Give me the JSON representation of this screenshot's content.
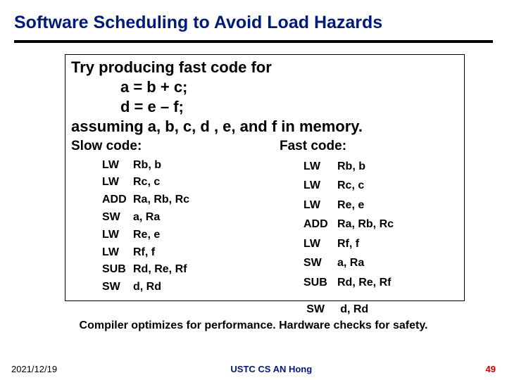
{
  "title": "Software Scheduling to Avoid Load Hazards",
  "intro": {
    "line1": "Try producing fast code for",
    "line2": "a = b + c;",
    "line3": "d = e – f;",
    "line4": "assuming a, b, c, d , e, and f in memory."
  },
  "slow": {
    "heading": "Slow code:",
    "rows": [
      {
        "op": "LW",
        "args": "Rb, b"
      },
      {
        "op": "LW",
        "args": "Rc, c"
      },
      {
        "op": "ADD",
        "args": "Ra, Rb, Rc"
      },
      {
        "op": "SW",
        "args": "a, Ra"
      },
      {
        "op": "LW",
        "args": "Re, e"
      },
      {
        "op": "LW",
        "args": "Rf, f"
      },
      {
        "op": "SUB",
        "args": "Rd, Re, Rf"
      },
      {
        "op": "SW",
        "args": "d, Rd"
      }
    ]
  },
  "fast": {
    "heading": "Fast code:",
    "rows": [
      {
        "op": "LW",
        "args": "Rb, b"
      },
      {
        "op": "LW",
        "args": "Rc, c"
      },
      {
        "op": "LW",
        "args": "Re, e"
      },
      {
        "op": "ADD",
        "args": "Ra, Rb, Rc"
      },
      {
        "op": "LW",
        "args": "Rf, f"
      },
      {
        "op": "SW",
        "args": "a, Ra"
      },
      {
        "op": "SUB",
        "args": "Rd, Re, Rf"
      }
    ],
    "overflow": {
      "op": "SW",
      "args": "d, Rd"
    }
  },
  "caption": "Compiler optimizes for performance.  Hardware checks for safety.",
  "footer": {
    "date": "2021/12/19",
    "center": "USTC CS AN Hong",
    "page": "49"
  }
}
